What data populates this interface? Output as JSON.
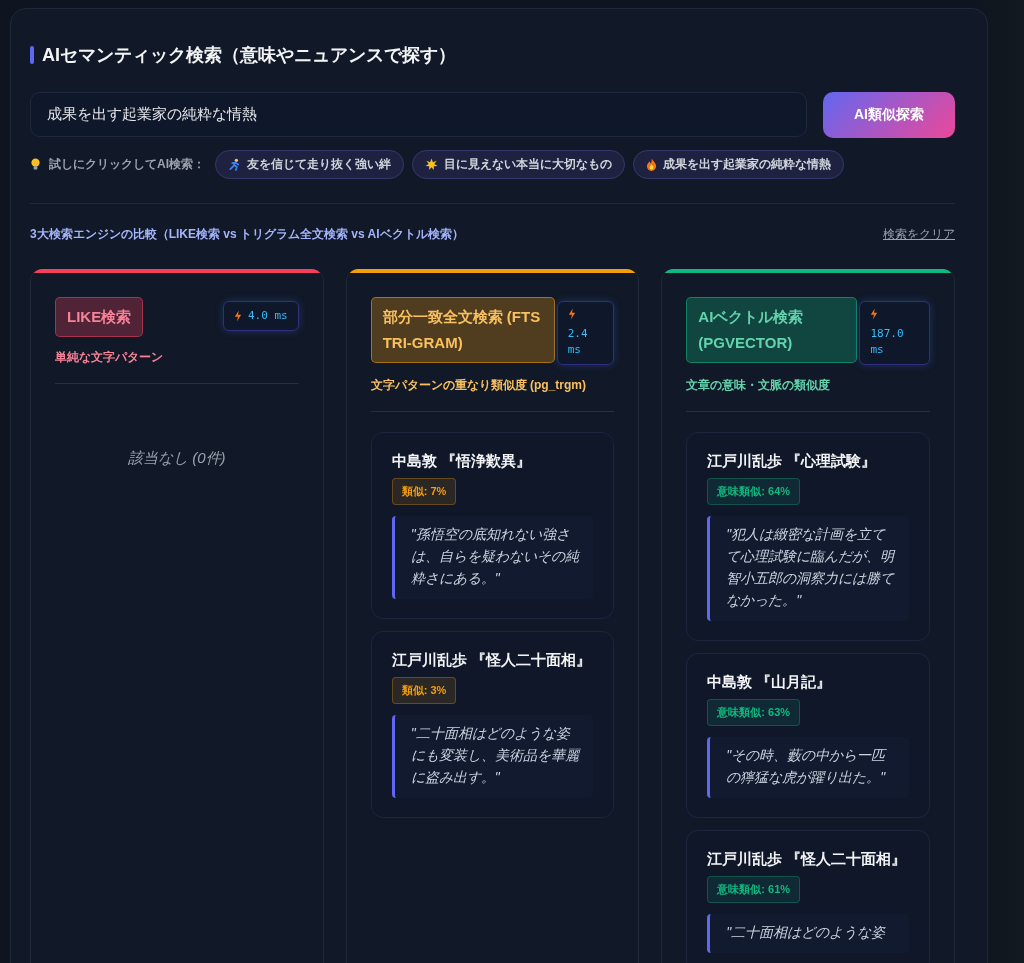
{
  "title": "AIセマンティック検索（意味やニュアンスで探す）",
  "search": {
    "value": "成果を出す起業家の純粋な情熱",
    "button": "AI類似探索"
  },
  "suggestions": {
    "label": "試しにクリックしてAI検索：",
    "items": [
      {
        "text": "友を信じて走り抜く強い絆"
      },
      {
        "text": "目に見えない本当に大切なもの"
      },
      {
        "text": "成果を出す起業家の純粋な情熱"
      }
    ]
  },
  "comparison": {
    "heading": "3大検索エンジンの比較（LIKE検索 vs トリグラム全文検索 vs AIベクトル検索）",
    "clear_link": "検索をクリア"
  },
  "engines": [
    {
      "name": "LIKE検索",
      "time": "4.0 ms",
      "description": "単純な文字パターン",
      "color": "#f43f5e",
      "empty_text": "該当なし (0件)"
    },
    {
      "name": "部分一致全文検索 (FTS TRI-GRAM)",
      "time": "2.4 ms",
      "description": "文字パターンの重なり類似度 (pg_trgm)",
      "color": "#f59e0b",
      "results": [
        {
          "title": "中島敦 『悟浄歎異』",
          "score": "類似: 7%",
          "quote": "\"孫悟空の底知れない強さは、自らを疑わないその純粋さにある。\""
        },
        {
          "title": "江戸川乱歩 『怪人二十面相』",
          "score": "類似: 3%",
          "quote": "\"二十面相はどのような姿にも変装し、美術品を華麗に盗み出す。\""
        }
      ]
    },
    {
      "name": "AIベクトル検索 (PGVECTOR)",
      "time": "187.0 ms",
      "description": "文章の意味・文脈の類似度",
      "color": "#10b981",
      "results": [
        {
          "title": "江戸川乱歩 『心理試験』",
          "score": "意味類似: 64%",
          "quote": "\"犯人は緻密な計画を立てて心理試験に臨んだが、明智小五郎の洞察力には勝てなかった。\""
        },
        {
          "title": "中島敦 『山月記』",
          "score": "意味類似: 63%",
          "quote": "\"その時、藪の中から一匹の獰猛な虎が躍り出た。\""
        },
        {
          "title": "江戸川乱歩 『怪人二十面相』",
          "score": "意味類似: 61%",
          "quote": "\"二十面相はどのような姿"
        }
      ]
    }
  ]
}
